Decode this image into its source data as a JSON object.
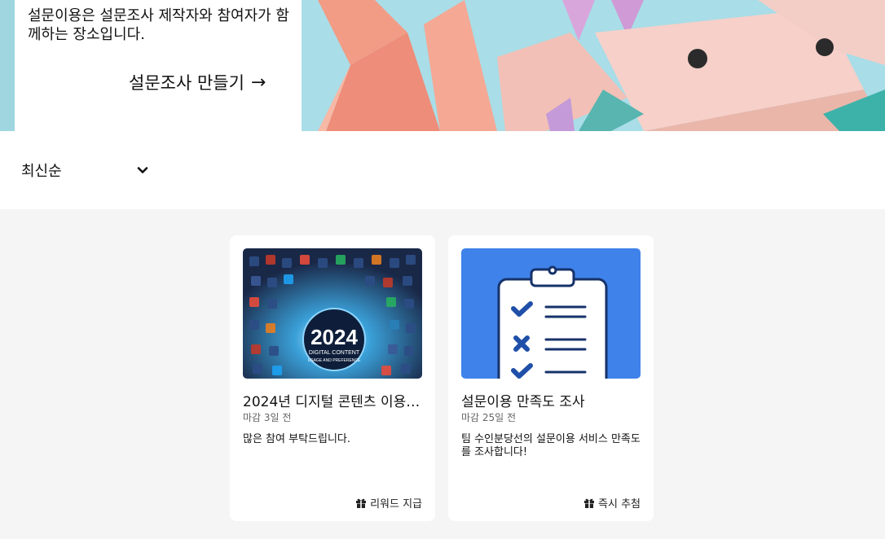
{
  "hero": {
    "intro_text": "설문이용은 설문조사 제작자와 참여자가 함께하는 장소입니다.",
    "cta_label": "설문조사 만들기",
    "cta_arrow": "→"
  },
  "filter": {
    "sort_selected": "최신순"
  },
  "surveys": [
    {
      "title": "2024년 디지털 콘텐츠 이용 ...",
      "thumb_text_big": "2024",
      "thumb_text_small_1": "DIGITAL CONTENT",
      "thumb_text_small_2": "USAGE AND PREFERENCE",
      "deadline": "마감 3일 전",
      "description": "많은 참여 부탁드립니다.",
      "reward": "리워드 지급"
    },
    {
      "title": "설문이용 만족도 조사",
      "deadline": "마감 25일 전",
      "description": "팀 수인분당선의 설문이용 서비스 만족도를 조사합니다!",
      "reward": "즉시 추첨"
    }
  ],
  "colors": {
    "clipboard_bg": "#3f82ea",
    "check": "#1f4fa8",
    "page_bg": "#f5f5f5"
  }
}
